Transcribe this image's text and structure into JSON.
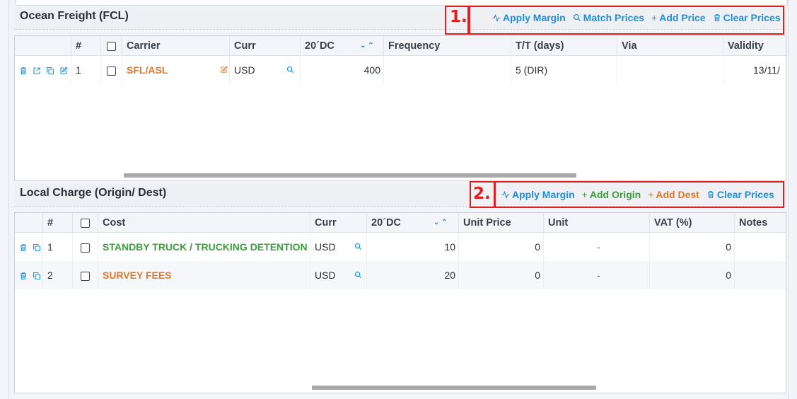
{
  "ocean": {
    "title": "Ocean Freight (FCL)",
    "badge": "1.",
    "actions": {
      "apply_margin": "Apply Margin",
      "match_prices": "Match Prices",
      "add_price": "Add Price",
      "clear_prices": "Clear Prices"
    },
    "columns": [
      "#",
      "Carrier",
      "Curr",
      "20´DC",
      "Frequency",
      "T/T (days)",
      "Via",
      "Validity"
    ],
    "rows": [
      {
        "num": "1",
        "carrier": "SFL/ASL",
        "curr": "USD",
        "price_20dc": "400",
        "frequency": "",
        "tt": "5 (DIR)",
        "via": "",
        "validity": "13/11/"
      }
    ]
  },
  "local": {
    "title": "Local Charge (Origin/ Dest)",
    "badge": "2.",
    "actions": {
      "apply_margin": "Apply Margin",
      "add_origin": "Add Origin",
      "add_dest": "Add Dest",
      "clear_prices": "Clear Prices"
    },
    "columns": [
      "#",
      "Cost",
      "Curr",
      "20´DC",
      "Unit Price",
      "Unit",
      "VAT (%)",
      "Notes"
    ],
    "rows": [
      {
        "num": "1",
        "cost": "STANDBY TRUCK / TRUCKING DETENTION CHARGE",
        "curr": "USD",
        "price_20dc": "10",
        "unit_price": "0",
        "unit": "-",
        "vat": "0",
        "notes": "",
        "color": "#3aa03a"
      },
      {
        "num": "2",
        "cost": "SURVEY FEES",
        "curr": "USD",
        "price_20dc": "20",
        "unit_price": "0",
        "unit": "-",
        "vat": "0",
        "notes": "",
        "color": "#e0782a"
      }
    ]
  },
  "colors": {
    "blue": "#1f8fd6",
    "green": "#3aa03a",
    "orange": "#e0782a",
    "highlight": "#e02020"
  }
}
